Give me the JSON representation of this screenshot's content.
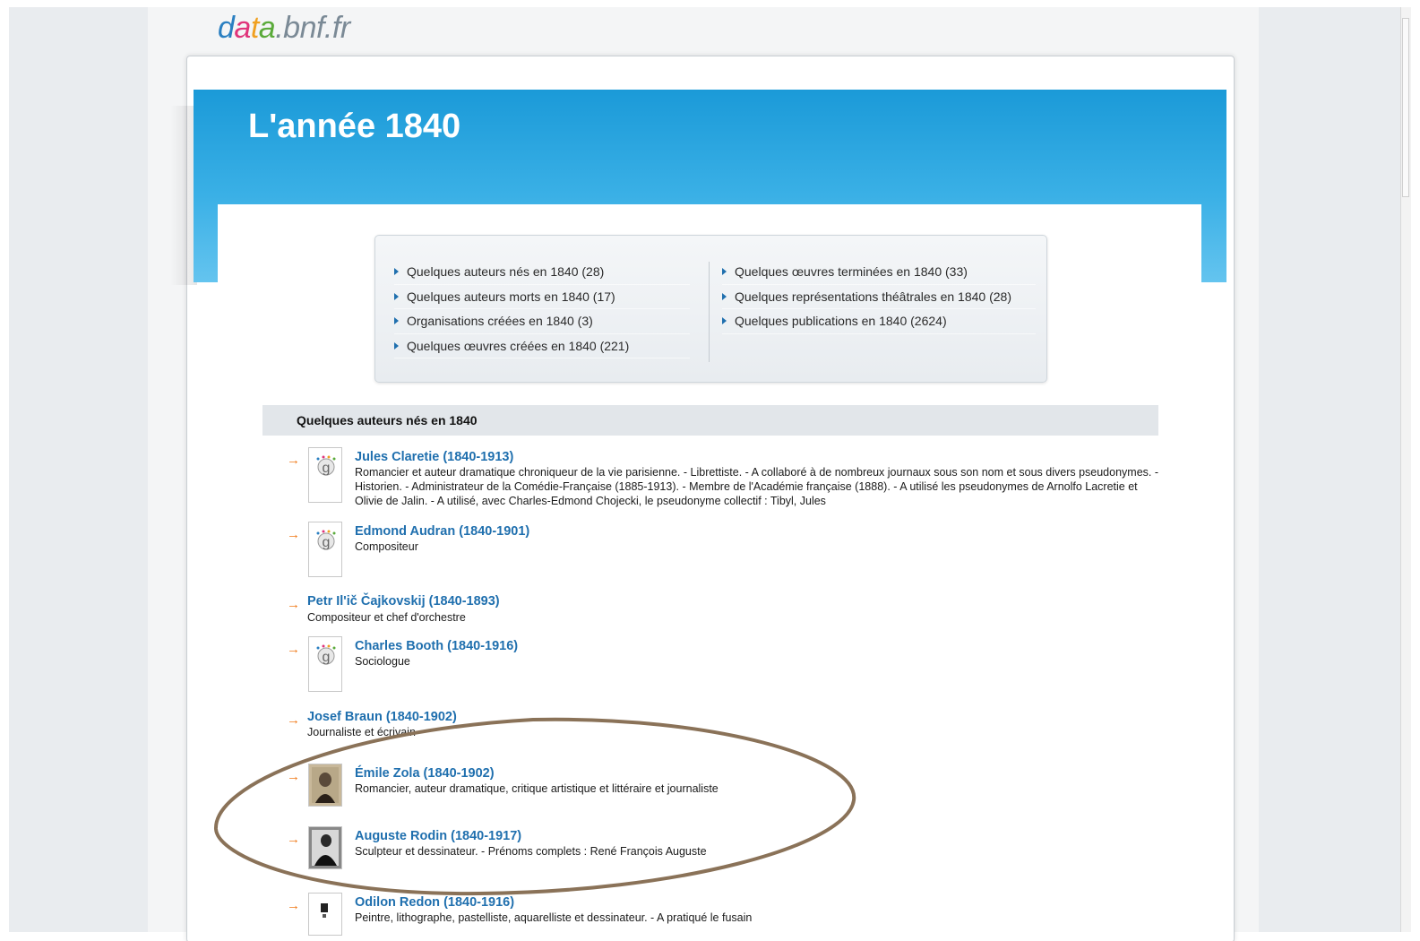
{
  "site": {
    "logo": {
      "d": "d",
      "a": "a",
      "t": "t",
      "a2": "a",
      "rest": ".bnf.fr"
    }
  },
  "page": {
    "title": "L'année 1840"
  },
  "summary": {
    "left": [
      {
        "label": "Quelques auteurs nés en 1840 (28)"
      },
      {
        "label": "Quelques auteurs morts en 1840 (17)"
      },
      {
        "label": "Organisations créées en 1840 (3)"
      },
      {
        "label": "Quelques œuvres créées en 1840 (221)"
      }
    ],
    "right": [
      {
        "label": "Quelques œuvres terminées en 1840 (33)"
      },
      {
        "label": "Quelques représentations théâtrales en 1840 (28)"
      },
      {
        "label": "Quelques publications en 1840 (2624)"
      }
    ]
  },
  "section": {
    "title": "Quelques auteurs nés en 1840"
  },
  "authors": [
    {
      "arrow": "→",
      "name": "Jules Claretie (1840-1913)",
      "desc": "Romancier et auteur dramatique chroniqueur de la vie parisienne. - Librettiste. - A collaboré à de nombreux journaux sous son nom et sous divers pseudonymes. - Historien. - Administrateur de la Comédie-Française (1885-1913). - Membre de l'Académie française (1888). - A utilisé les pseudonymes de Arnolfo Lacretie et Olivie de Jalin. - A utilisé, avec Charles-Edmond Chojecki, le pseudonyme collectif : Tibyl, Jules"
    },
    {
      "arrow": "→",
      "name": "Edmond Audran (1840-1901)",
      "desc": "Compositeur"
    },
    {
      "arrow": "→",
      "name": "Petr Il'ič Čajkovskij (1840-1893)",
      "desc": "Compositeur et chef d'orchestre"
    },
    {
      "arrow": "→",
      "name": "Charles Booth (1840-1916)",
      "desc": "Sociologue"
    },
    {
      "arrow": "→",
      "name": "Josef Braun (1840-1902)",
      "desc": "Journaliste et écrivain"
    },
    {
      "arrow": "→",
      "name": "Émile Zola (1840-1902)",
      "desc": "Romancier, auteur dramatique, critique artistique et littéraire et journaliste"
    },
    {
      "arrow": "→",
      "name": "Auguste Rodin (1840-1917)",
      "desc": "Sculpteur et dessinateur. - Prénoms complets : René François Auguste"
    },
    {
      "arrow": "→",
      "name": "Odilon Redon (1840-1916)",
      "desc": "Peintre, lithographe, pastelliste, aquarelliste et dessinateur. - A pratiqué le fusain"
    }
  ]
}
